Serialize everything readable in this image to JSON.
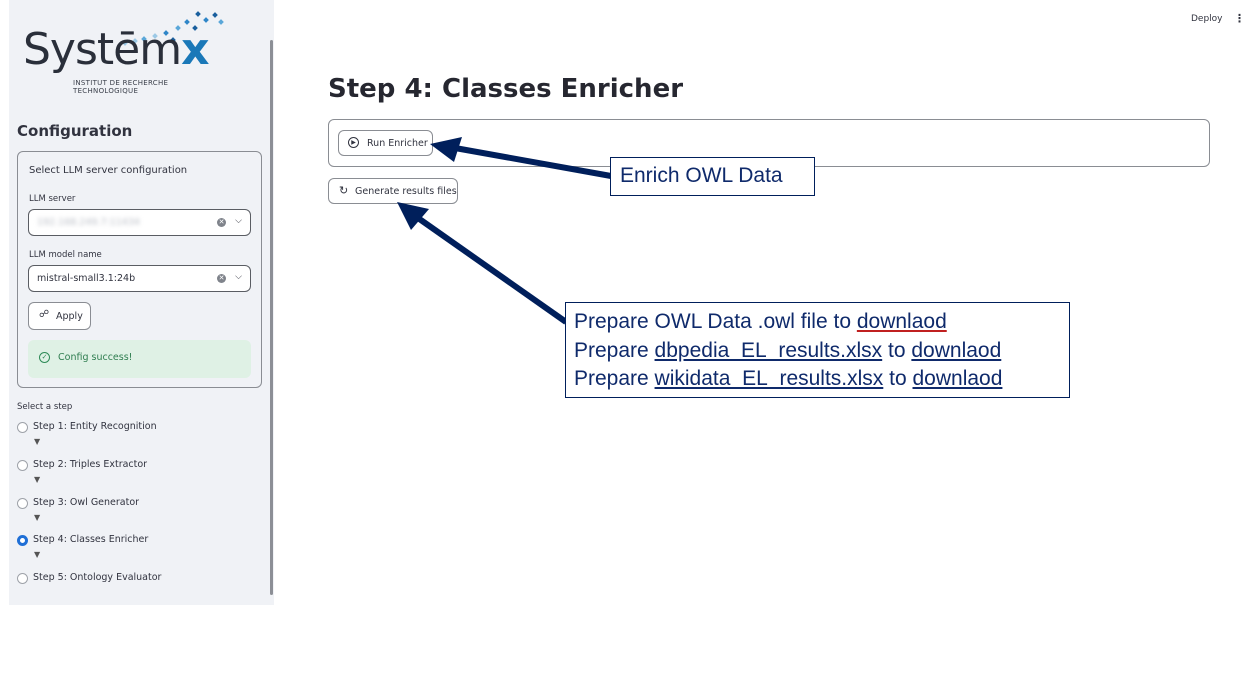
{
  "header": {
    "deploy_label": "Deploy",
    "menu_icon": "kebab-menu-icon"
  },
  "sidebar": {
    "logo": {
      "brand": "Systemx",
      "brand_main": "Systēm",
      "brand_x": "x",
      "subtitle_line1": "INSTITUT DE RECHERCHE",
      "subtitle_line2": "TECHNOLOGIQUE"
    },
    "config_title": "Configuration",
    "config_subtitle": "Select LLM server configuration",
    "llm_server_label": "LLM server",
    "llm_server_value": "192.168.249.7:11434",
    "llm_model_label": "LLM model name",
    "llm_model_value": "mistral-small3.1:24b",
    "apply_label": "Apply",
    "success_message": "Config success!",
    "step_select_label": "Select a step",
    "steps": [
      {
        "label": "Step 1: Entity Recognition",
        "selected": false
      },
      {
        "label": "Step 2: Triples Extractor",
        "selected": false
      },
      {
        "label": "Step 3: Owl Generator",
        "selected": false
      },
      {
        "label": "Step 4: Classes Enricher",
        "selected": true
      },
      {
        "label": "Step 5: Ontology Evaluator",
        "selected": false
      }
    ],
    "step_arrow": "▼"
  },
  "main": {
    "title": "Step 4: Classes Enricher",
    "run_button_label": "Run Enricher",
    "generate_button_label": "Generate results files"
  },
  "annotations": {
    "note1": "Enrich OWL Data",
    "note2": {
      "line1_prefix": "Prepare OWL Data .owl file to ",
      "line1_link": "downlaod",
      "line2_prefix": "Prepare ",
      "line2_file": "dbpedia_EL_results.xlsx",
      "line2_mid": " to ",
      "line2_link": "downlaod",
      "line3_prefix": "Prepare ",
      "line3_file": "wikidata_EL_results.xlsx",
      "line3_mid": " to ",
      "line3_link": "downlaod"
    },
    "arrow_color": "#001f5b"
  }
}
